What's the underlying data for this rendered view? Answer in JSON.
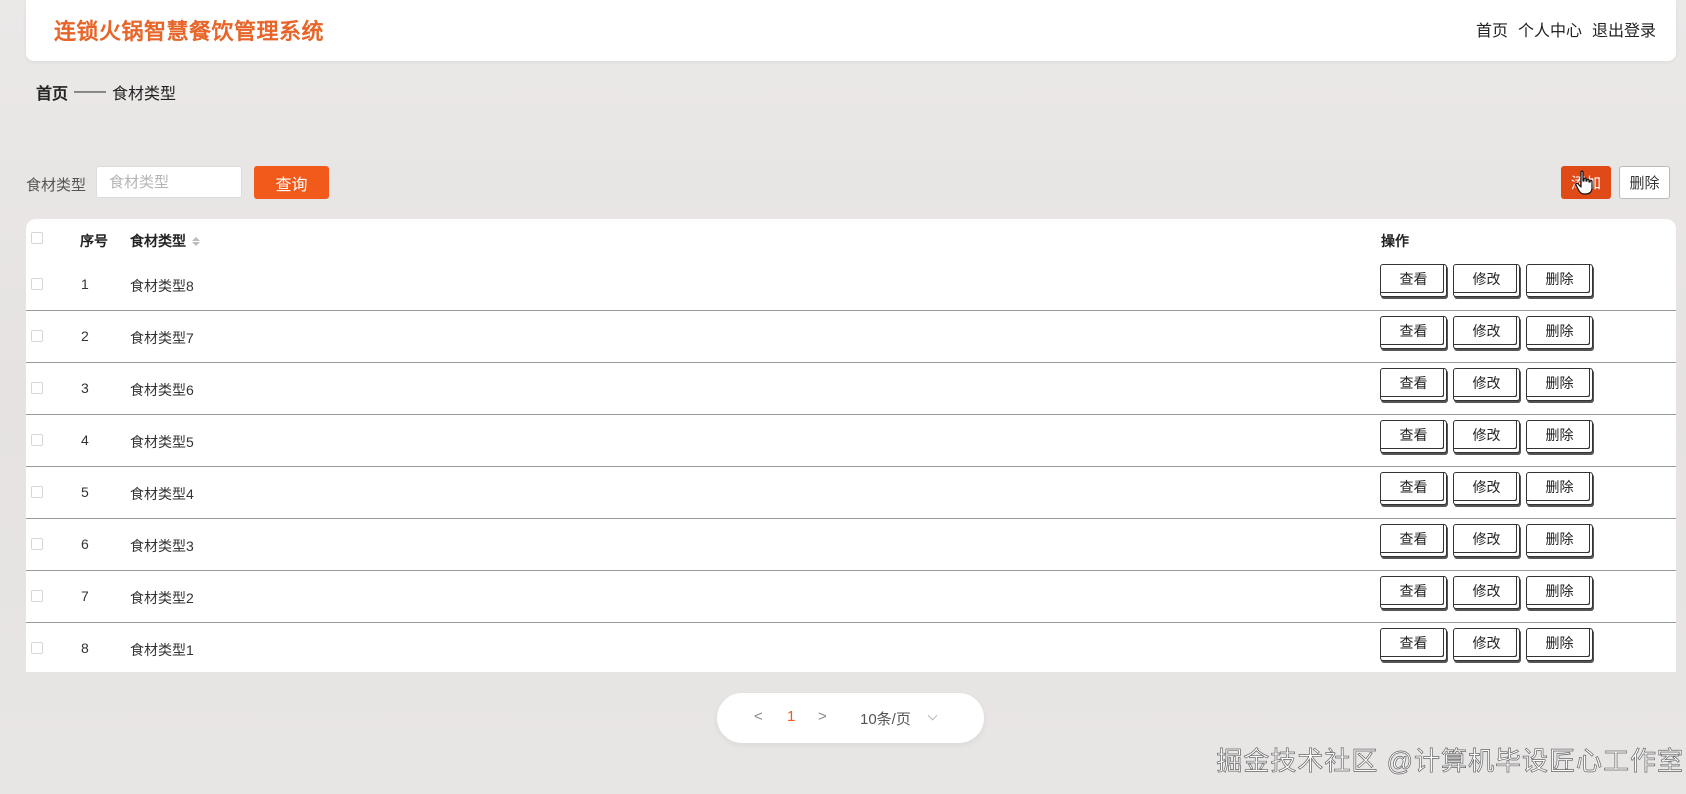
{
  "header": {
    "app_title": "连锁火锅智慧餐饮管理系统",
    "nav": [
      "首页",
      "个人中心",
      "退出登录"
    ]
  },
  "breadcrumb": {
    "home": "首页",
    "separator": "——",
    "current": "食材类型"
  },
  "search": {
    "label": "食材类型",
    "placeholder": "食材类型",
    "query_button": "查询"
  },
  "toolbar": {
    "add_button": "添加",
    "delete_button": "删除"
  },
  "table": {
    "columns": {
      "index": "序号",
      "type": "食材类型",
      "actions": "操作"
    },
    "rows": [
      {
        "index": "1",
        "type": "食材类型8"
      },
      {
        "index": "2",
        "type": "食材类型7"
      },
      {
        "index": "3",
        "type": "食材类型6"
      },
      {
        "index": "4",
        "type": "食材类型5"
      },
      {
        "index": "5",
        "type": "食材类型4"
      },
      {
        "index": "6",
        "type": "食材类型3"
      },
      {
        "index": "7",
        "type": "食材类型2"
      },
      {
        "index": "8",
        "type": "食材类型1"
      }
    ],
    "row_actions": {
      "view": "查看",
      "edit": "修改",
      "delete": "删除"
    }
  },
  "pagination": {
    "prev": "<",
    "current_page": "1",
    "next": ">",
    "page_size": "10条/页"
  },
  "watermark": "掘金技术社区 @计算机毕设匠心工作室",
  "colors": {
    "brand": "#e8652a",
    "primary_button": "#f25a1c",
    "add_button": "#e04a17"
  }
}
